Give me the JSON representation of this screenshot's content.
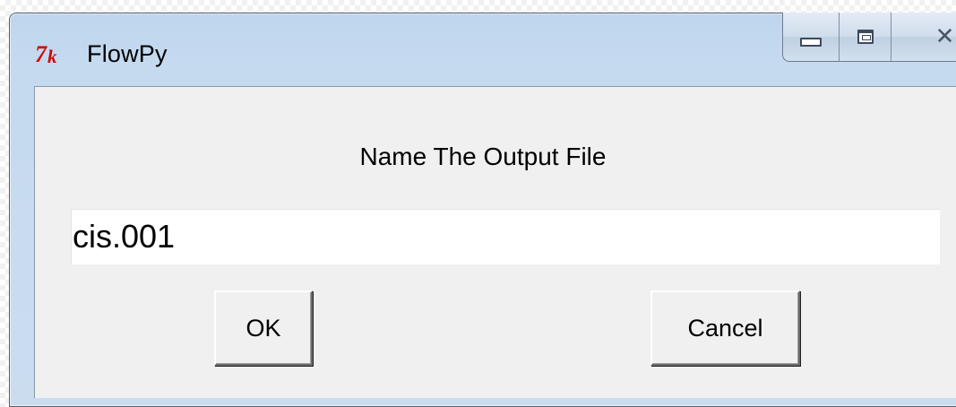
{
  "window": {
    "title": "FlowPy",
    "icon": "tk-feather-icon",
    "caption_buttons": {
      "minimize": "minimize-icon",
      "maximize": "maximize-icon",
      "close": "close-icon"
    }
  },
  "dialog": {
    "prompt": "Name The Output File",
    "input_value": "cis.001",
    "ok_label": "OK",
    "cancel_label": "Cancel"
  },
  "colors": {
    "titlebar": "#c3d8ee",
    "client_background": "#f0f0f0",
    "tk_icon_red": "#d40000"
  }
}
